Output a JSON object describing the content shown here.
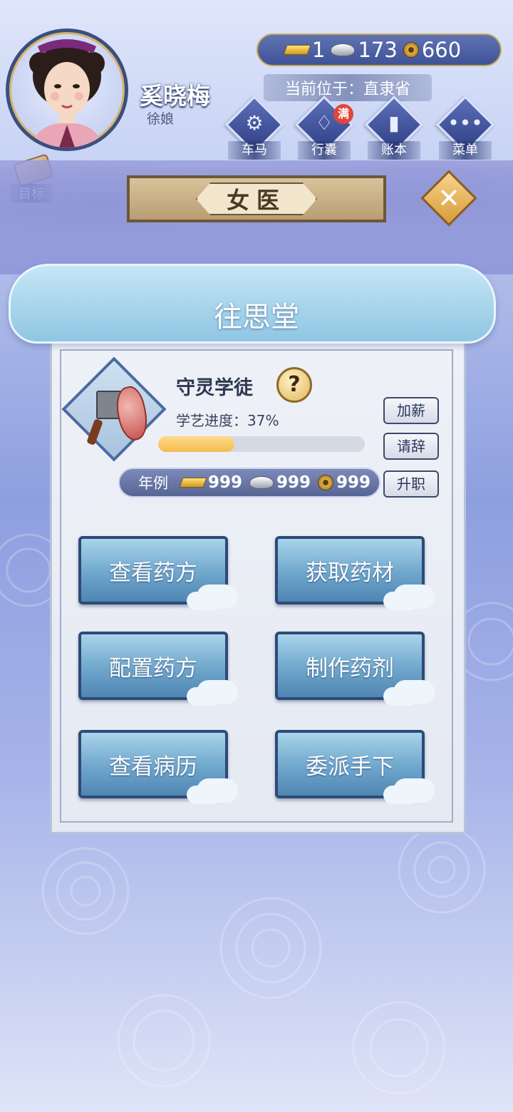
{
  "player": {
    "name": "奚晓梅",
    "title": "徐娘"
  },
  "currency": {
    "gold": "1",
    "silver": "173",
    "coin": "660"
  },
  "location": {
    "label": "当前位于：",
    "value": "直隶省"
  },
  "menu": [
    {
      "label": "车马",
      "icon": "carriage-icon"
    },
    {
      "label": "行囊",
      "icon": "bag-icon",
      "badge": "满"
    },
    {
      "label": "账本",
      "icon": "ledger-icon"
    },
    {
      "label": "菜单",
      "icon": "more-icon"
    }
  ],
  "goal": {
    "label": "目标"
  },
  "banner": {
    "title": "女医"
  },
  "hall": {
    "title": "往思堂"
  },
  "job": {
    "name": "守灵学徒",
    "help": "?",
    "progress_label": "学艺进度：37%",
    "progress": 0.37
  },
  "side_buttons": {
    "raise": "加薪",
    "resign": "请辞",
    "promote": "升职"
  },
  "salary": {
    "label": "年例",
    "gold": "999",
    "silver": "999",
    "coin": "999"
  },
  "actions": {
    "view_recipes": "查看药方",
    "get_herbs": "获取药材",
    "mix_recipe": "配置药方",
    "make_medicine": "制作药剂",
    "view_records": "查看病历",
    "dispatch": "委派手下"
  },
  "colors": {
    "panel_border": "#2e4a78",
    "progress": "#f3bd4d",
    "badge": "#e0463c"
  }
}
